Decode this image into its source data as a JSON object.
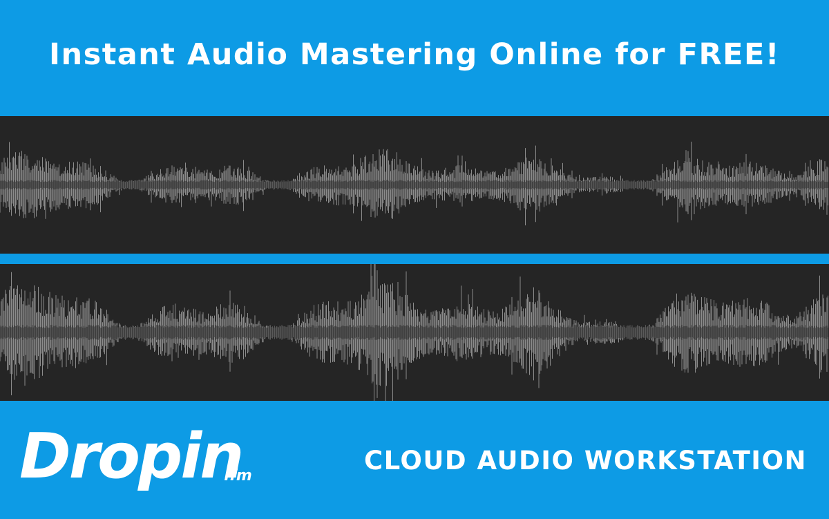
{
  "banner": {
    "headline": "Instant Audio Mastering Online for FREE!",
    "tagline": "CLOUD AUDIO WORKSTATION"
  },
  "brand": {
    "name": "Dropin",
    "suffix": ".fm"
  },
  "colors": {
    "background": "#0d9be5",
    "track": "#252525",
    "waveform": "#8c8c8c",
    "waveform_core": "#5a5a5a",
    "text": "#ffffff"
  },
  "icons": {
    "waveform_top": "waveform-icon",
    "waveform_bottom": "waveform-icon"
  }
}
